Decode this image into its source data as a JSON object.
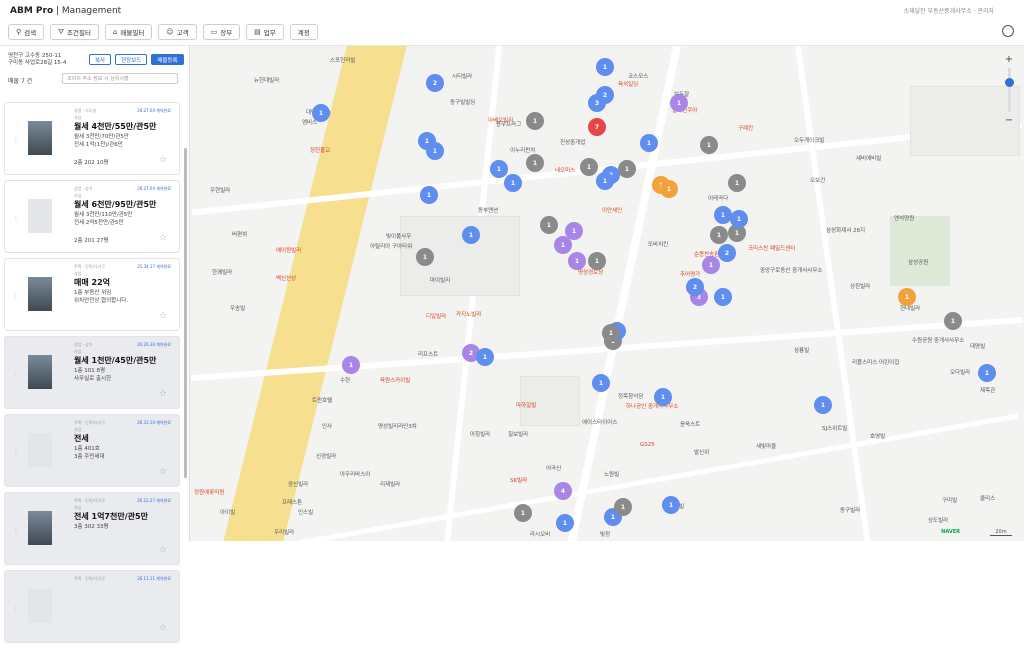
{
  "app": {
    "brand": "ABM Pro",
    "org": "| Management",
    "top_right": "소재달인 부동산중개사무소 · 관리자"
  },
  "nav": [
    {
      "label": "검색",
      "icon": "search-icon"
    },
    {
      "label": "조건필터",
      "icon": "filter-icon"
    },
    {
      "label": "매물필터",
      "icon": "building-icon"
    },
    {
      "label": "고객",
      "icon": "users-icon"
    },
    {
      "label": "장부",
      "icon": "folder-icon"
    },
    {
      "label": "업무",
      "icon": "document-icon"
    },
    {
      "label": "계정",
      "icon": ""
    }
  ],
  "panel": {
    "address_line1": "영천구 고수동 250-11",
    "address_line2": "구미동 사업로28길 15-4",
    "btn_copy": "복사",
    "btn_roadview": "현장보드",
    "btn_register": "매물등록",
    "count": "매물 7 건",
    "search_placeholder": "조이의 주소 정보 시 상위시행"
  },
  "cards": [
    {
      "tag": "상업 · 사무실",
      "date": "26.27.04 계약완료",
      "sub": "사업",
      "title": "월세 4천만/55만/관5만",
      "line1": "월세 3천만/70만/관5만",
      "line2": "전세 1억(1천)/관6만",
      "line3": "2층 202 10평",
      "thumb": "photo",
      "gray": false
    },
    {
      "tag": "상업 · 상가",
      "date": "26.27.04 계약완료",
      "sub": "사업",
      "title": "월세 6천만/95만/관5만",
      "line1": "월세 3천만/110만/관5만",
      "line2": "전세 2억5천만/관5만",
      "line3": "2층 201 27평",
      "thumb": "ph",
      "gray": false
    },
    {
      "tag": "주택 · 단독/다가구",
      "date": "25.34.17 계약완료",
      "sub": "사업",
      "title": "매매 22억",
      "line1": "1층 부동산 위임",
      "line2": "위치안전상 협의합니다.",
      "line3": "",
      "thumb": "photo",
      "gray": false
    },
    {
      "tag": "상업 · 상가",
      "date": "26.26.30 계약완료",
      "sub": "사업",
      "title": "월세 1천만/45만/관5만",
      "line1": "1층 101 8평",
      "line2": "사무실로 출시한",
      "line3": "",
      "thumb": "photo",
      "gray": true
    },
    {
      "tag": "주택 · 단독/다가구",
      "date": "26.33.10 계약완료",
      "sub": "사업",
      "title": "전세",
      "line1": "1층 401호",
      "line2": "3층 주민세대",
      "line3": "",
      "thumb": "ph",
      "gray": true
    },
    {
      "tag": "주택 · 단독/다가구",
      "date": "26.22.27 계약완료",
      "sub": "사업",
      "title": "전세 1억7천만/관5만",
      "line1": "3층 302 33평",
      "line2": "",
      "line3": "",
      "thumb": "photo",
      "gray": true
    },
    {
      "tag": "주택 · 단독/다가구",
      "date": "26.11.11 계약완료",
      "sub": "",
      "title": "",
      "line1": "",
      "line2": "",
      "line3": "",
      "thumb": "ph",
      "gray": true
    }
  ],
  "map": {
    "labels": [
      "스포헌저빌",
      "뉴헌대빌라",
      "대명바오스",
      "엠비스",
      "정헌불교",
      "우현빌라",
      "버편뷔",
      "한쾌빌라",
      "벡신산상",
      "에이원빌라",
      "우송빌",
      "아베오빌리",
      "시티빌라",
      "동구빌빌딩",
      "용우프라그",
      "이누리펀치",
      "진성중개업",
      "네오미스",
      "코스모스",
      "육석일딩",
      "보두잘",
      "딸파인쿠아",
      "구례칸",
      "오두게이크빌",
      "세비에비빌",
      "오보건",
      "이레곡다",
      "아틸리아 구아타워",
      "빛이풀사우",
      "동부앤션",
      "명성경로당",
      "이안세인",
      "또바치킨",
      "추어명가",
      "순몽찬송판",
      "크리스찬 패밀드센터",
      "삼성화재서 28지",
      "엔석양원",
      "삼성공원",
      "중앙구로동산 중개사사무소",
      "상흰빌라",
      "현대빌라",
      "마이빌리",
      "카지노빌라",
      "디일빌라",
      "리프스트",
      "육원스카이빌",
      "수현",
      "트윈호텔",
      "마하일빌",
      "정목참식당",
      "하나공인 중개사사무소",
      "에이스타이어스",
      "아침빌라",
      "칠보빌라",
      "명성빌리라인3차",
      "인사",
      "선경빌라",
      "SK빌라",
      "어곡신",
      "노원빌",
      "GS25",
      "윤욱스트",
      "발신위",
      "새빛마을",
      "호영빌",
      "정원애꽃미원",
      "프레스톤",
      "광신빌라",
      "아우리바스이",
      "리제빌라",
      "우리빌라",
      "클리스",
      "구미빌",
      "상도빌라",
      "삼룡빌",
      "리플스미스 어린이집",
      "대명빌",
      "수원공원 중개사사무소",
      "오다빌라",
      "SJ스위트빌",
      "뉴라운빌",
      "동구빌라",
      "인스빌",
      "아이빌",
      "라시오비",
      "빛정",
      "제목관"
    ],
    "clusters": [
      {
        "n": "1",
        "c": "b"
      },
      {
        "n": "2",
        "c": "b"
      },
      {
        "n": "1",
        "c": "b"
      },
      {
        "n": "1",
        "c": "b"
      },
      {
        "n": "2",
        "c": "b"
      },
      {
        "n": "1",
        "c": "b"
      },
      {
        "n": "3",
        "c": "b"
      },
      {
        "n": "1",
        "c": "b"
      },
      {
        "n": "1",
        "c": "b"
      },
      {
        "n": "1",
        "c": "b"
      },
      {
        "n": "1",
        "c": "g"
      },
      {
        "n": "1",
        "c": "g"
      },
      {
        "n": "1",
        "c": "g"
      },
      {
        "n": "1",
        "c": "g"
      },
      {
        "n": "1",
        "c": "g"
      },
      {
        "n": "1",
        "c": "g"
      },
      {
        "n": "2",
        "c": "b"
      },
      {
        "n": "7",
        "c": "r"
      },
      {
        "n": "1",
        "c": "b"
      },
      {
        "n": "1",
        "c": "b"
      },
      {
        "n": "1",
        "c": "g"
      },
      {
        "n": "2",
        "c": "b"
      },
      {
        "n": "1",
        "c": "o"
      },
      {
        "n": "1",
        "c": "g"
      },
      {
        "n": "1",
        "c": "b"
      },
      {
        "n": "1",
        "c": "p"
      },
      {
        "n": "1",
        "c": "p"
      },
      {
        "n": "1",
        "c": "p"
      },
      {
        "n": "1",
        "c": "p"
      },
      {
        "n": "3",
        "c": "p"
      },
      {
        "n": "1",
        "c": "g"
      },
      {
        "n": "1",
        "c": "g"
      },
      {
        "n": "1",
        "c": "b"
      },
      {
        "n": "1",
        "c": "o"
      },
      {
        "n": "1",
        "c": "g"
      },
      {
        "n": "2",
        "c": "b"
      },
      {
        "n": "1",
        "c": "p"
      },
      {
        "n": "2",
        "c": "p"
      },
      {
        "n": "1",
        "c": "b"
      },
      {
        "n": "1",
        "c": "b"
      },
      {
        "n": "1",
        "c": "b"
      },
      {
        "n": "1",
        "c": "g"
      },
      {
        "n": "1",
        "c": "b"
      },
      {
        "n": "1",
        "c": "g"
      },
      {
        "n": "1",
        "c": "b"
      },
      {
        "n": "4",
        "c": "p"
      },
      {
        "n": "1",
        "c": "b"
      },
      {
        "n": "1",
        "c": "b"
      },
      {
        "n": "1",
        "c": "g"
      },
      {
        "n": "1",
        "c": "o"
      },
      {
        "n": "1",
        "c": "g"
      },
      {
        "n": "1",
        "c": "b"
      },
      {
        "n": "1",
        "c": "b"
      },
      {
        "n": "1",
        "c": "b"
      },
      {
        "n": "1",
        "c": "b"
      },
      {
        "n": "1",
        "c": "g"
      },
      {
        "n": "1",
        "c": "p"
      }
    ],
    "naver": "NAVER",
    "scale": "20m"
  }
}
